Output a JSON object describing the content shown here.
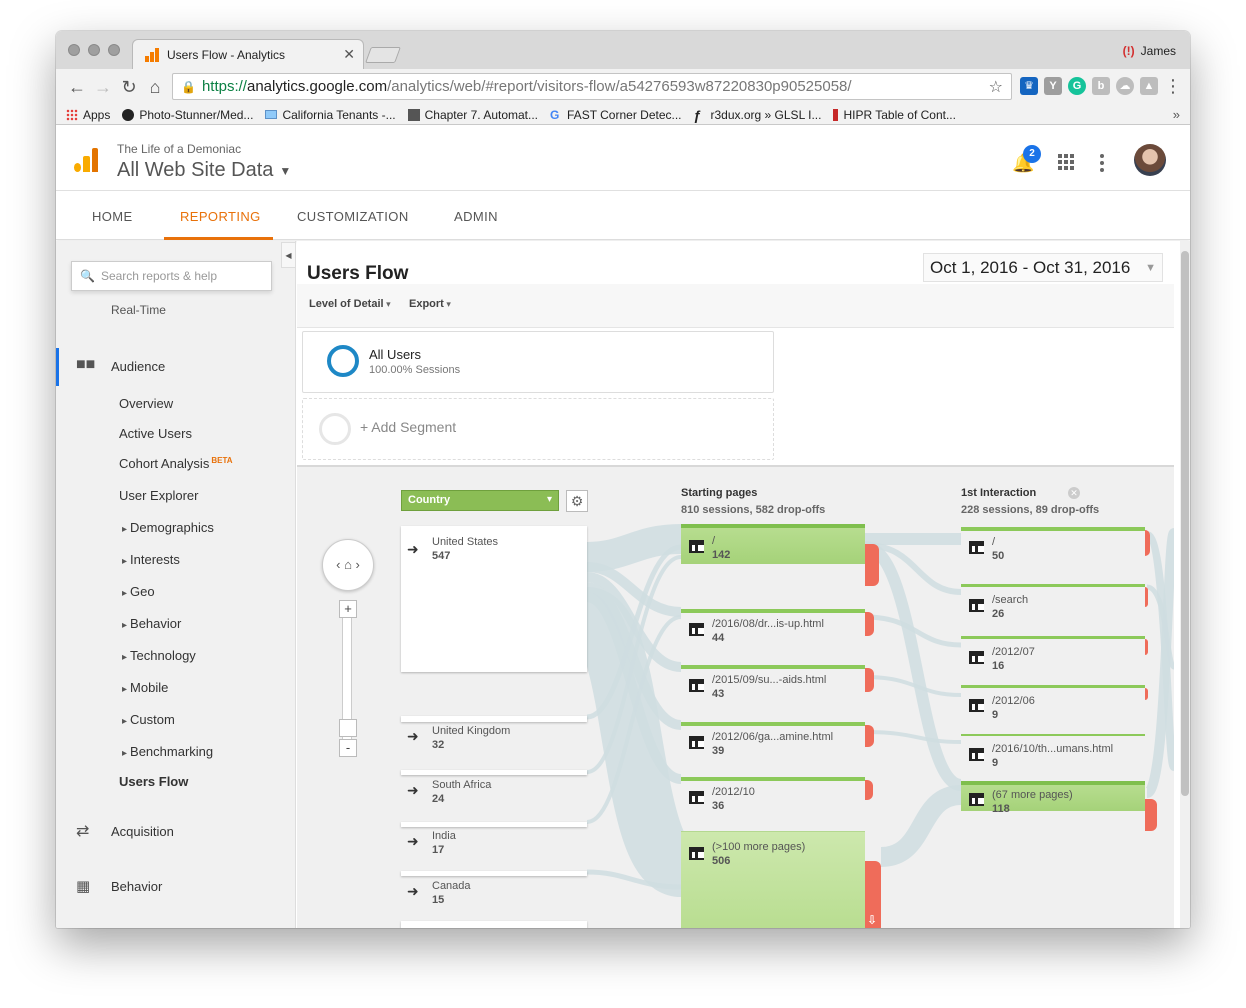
{
  "browser": {
    "tab_title": "Users Flow - Analytics",
    "tab_close": "✕",
    "profile_name": "James",
    "url_scheme": "https://",
    "url_domain": "analytics.google.com",
    "url_path": "/analytics/web/#report/visitors-flow/a54276593w87220830p90525058/",
    "bookmarks": [
      "Apps",
      "Photo-Stunner/Med...",
      "California Tenants -...",
      "Chapter 7. Automat...",
      "FAST Corner Detec...",
      "r3dux.org » GLSL I...",
      "HIPR Table of Cont..."
    ],
    "bookmarks_more": "»"
  },
  "ga": {
    "account": "The Life of a Demoniac",
    "property": "All Web Site Data",
    "notification_count": "2",
    "nav": [
      "HOME",
      "REPORTING",
      "CUSTOMIZATION",
      "ADMIN"
    ],
    "active_nav": "REPORTING"
  },
  "sidebar": {
    "search_placeholder": "Search reports & help",
    "realtime": "Real-Time",
    "audience": "Audience",
    "audience_items": [
      "Overview",
      "Active Users",
      "Cohort Analysis",
      "User Explorer",
      "Demographics",
      "Interests",
      "Geo",
      "Behavior",
      "Technology",
      "Mobile",
      "Custom",
      "Benchmarking",
      "Users Flow"
    ],
    "beta_label": "BETA",
    "acquisition": "Acquisition",
    "behavior": "Behavior"
  },
  "report": {
    "title": "Users Flow",
    "date_range": "Oct 1, 2016 - Oct 31, 2016",
    "level_of_detail": "Level of Detail",
    "export": "Export",
    "segment_name": "All Users",
    "segment_pct": "100.00% Sessions",
    "add_segment": "+ Add Segment"
  },
  "flow": {
    "dimension": "Country",
    "countries": [
      {
        "name": "United States",
        "value": "547"
      },
      {
        "name": "United Kingdom",
        "value": "32"
      },
      {
        "name": "South Africa",
        "value": "24"
      },
      {
        "name": "India",
        "value": "17"
      },
      {
        "name": "Canada",
        "value": "15"
      }
    ],
    "starting_title": "Starting pages",
    "starting_sub": "810 sessions, 582 drop-offs",
    "starting_pages": [
      {
        "name": "/",
        "value": "142"
      },
      {
        "name": "/2016/08/dr...is-up.html",
        "value": "44"
      },
      {
        "name": "/2015/09/su...-aids.html",
        "value": "43"
      },
      {
        "name": "/2012/06/ga...amine.html",
        "value": "39"
      },
      {
        "name": "/2012/10",
        "value": "36"
      },
      {
        "name": "(>100 more pages)",
        "value": "506"
      }
    ],
    "interaction_title": "1st Interaction",
    "interaction_sub": "228 sessions, 89 drop-offs",
    "interaction_pages": [
      {
        "name": "/",
        "value": "50"
      },
      {
        "name": "/search",
        "value": "26"
      },
      {
        "name": "/2012/07",
        "value": "16"
      },
      {
        "name": "/2012/06",
        "value": "9"
      },
      {
        "name": "/2016/10/th...umans.html",
        "value": "9"
      },
      {
        "name": "(67 more pages)",
        "value": "118"
      }
    ]
  },
  "colors": {
    "accent": "#e8710a",
    "node_green": "#a5d279",
    "dropoff_red": "#ef6c5a",
    "link_blue": "#1a73e8"
  }
}
